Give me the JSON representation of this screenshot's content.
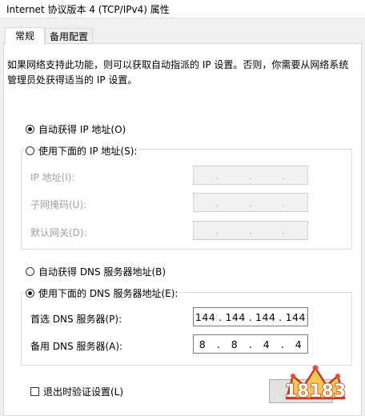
{
  "window": {
    "title": "Internet 协议版本 4 (TCP/IPv4) 属性"
  },
  "tabs": [
    {
      "label": "常规",
      "active": true
    },
    {
      "label": "备用配置",
      "active": false
    }
  ],
  "description": "如果网络支持此功能，则可以获取自动指派的 IP 设置。否则，你需要从网络系统管理员处获得适当的 IP 设置。",
  "ip": {
    "auto_label": "自动获得 IP 地址(O)",
    "auto_checked": true,
    "manual_label": "使用下面的 IP 地址(S):",
    "manual_checked": false,
    "fields": [
      {
        "label": "IP 地址(I):",
        "octets": [
          "",
          "",
          "",
          ""
        ]
      },
      {
        "label": "子网掩码(U):",
        "octets": [
          "",
          "",
          "",
          ""
        ]
      },
      {
        "label": "默认网关(D):",
        "octets": [
          "",
          "",
          "",
          ""
        ]
      }
    ]
  },
  "dns": {
    "auto_label": "自动获得 DNS 服务器地址(B)",
    "auto_checked": false,
    "manual_label": "使用下面的 DNS 服务器地址(E):",
    "manual_checked": true,
    "fields": [
      {
        "label": "首选 DNS 服务器(P):",
        "octets": [
          "144",
          "144",
          "144",
          "144"
        ]
      },
      {
        "label": "备用 DNS 服务器(A):",
        "octets": [
          "8",
          "8",
          "4",
          "4"
        ]
      }
    ]
  },
  "validate": {
    "label": "退出时验证设置(L)",
    "checked": false
  },
  "watermark": {
    "text": "18183"
  },
  "colors": {
    "field_border": "#7a7a7a",
    "disabled_text": "#a0a0a0",
    "panel_bg": "#ffffff"
  }
}
